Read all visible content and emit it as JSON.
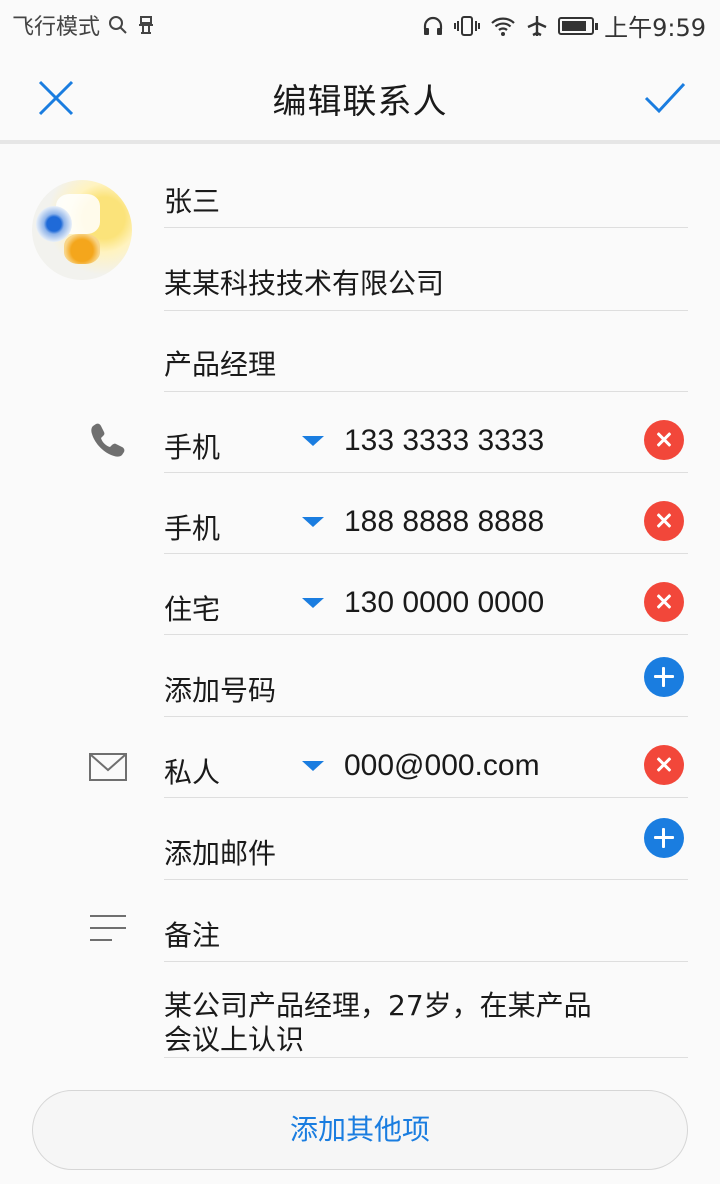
{
  "status": {
    "left_text": "飞行模式",
    "time": "上午9:59"
  },
  "appbar": {
    "title": "编辑联系人"
  },
  "contact": {
    "name": "张三",
    "company": "某某科技技术有限公司",
    "position": "产品经理"
  },
  "phones": [
    {
      "type": "手机",
      "number": "133 3333 3333"
    },
    {
      "type": "手机",
      "number": "188 8888 8888"
    },
    {
      "type": "住宅",
      "number": "130 0000 0000"
    }
  ],
  "add_phone_label": "添加号码",
  "emails": [
    {
      "type": "私人",
      "address": "000@000.com"
    }
  ],
  "add_email_label": "添加邮件",
  "notes": {
    "label": "备注",
    "line1": "某公司产品经理，27岁，在某产品",
    "line2": "会议上认识"
  },
  "add_more_label": "添加其他项",
  "colors": {
    "accent": "#1a7de0",
    "delete": "#f2473a"
  }
}
